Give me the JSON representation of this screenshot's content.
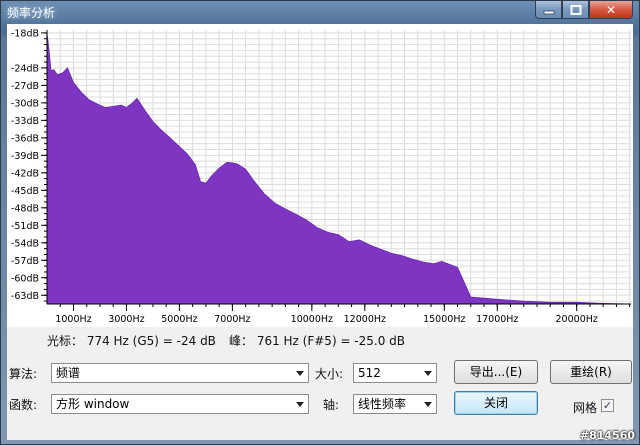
{
  "window": {
    "title": "频率分析",
    "min_label": "",
    "max_label": "",
    "close_label": "✕"
  },
  "chart_data": {
    "type": "area",
    "title": "",
    "xlabel": "",
    "ylabel": "",
    "xlim": [
      0,
      22050
    ],
    "ylim": [
      -64.5,
      -17.5
    ],
    "fill_color": "#7d35c2",
    "grid": true,
    "y_ticks": [
      {
        "v": -18,
        "label": "-18dB"
      },
      {
        "v": -24,
        "label": "-24dB"
      },
      {
        "v": -27,
        "label": "-27dB"
      },
      {
        "v": -30,
        "label": "-30dB"
      },
      {
        "v": -33,
        "label": "-33dB"
      },
      {
        "v": -36,
        "label": "-36dB"
      },
      {
        "v": -39,
        "label": "-39dB"
      },
      {
        "v": -42,
        "label": "-42dB"
      },
      {
        "v": -45,
        "label": "-45dB"
      },
      {
        "v": -48,
        "label": "-48dB"
      },
      {
        "v": -51,
        "label": "-51dB"
      },
      {
        "v": -54,
        "label": "-54dB"
      },
      {
        "v": -57,
        "label": "-57dB"
      },
      {
        "v": -60,
        "label": "-60dB"
      },
      {
        "v": -63,
        "label": "-63dB"
      }
    ],
    "x_ticks": [
      {
        "v": 1000,
        "label": "1000Hz"
      },
      {
        "v": 3000,
        "label": "3000Hz"
      },
      {
        "v": 5000,
        "label": "5000Hz"
      },
      {
        "v": 7000,
        "label": "7000Hz"
      },
      {
        "v": 10000,
        "label": "10000Hz"
      },
      {
        "v": 12000,
        "label": "12000Hz"
      },
      {
        "v": 15000,
        "label": "15000Hz"
      },
      {
        "v": 17000,
        "label": "17000Hz"
      },
      {
        "v": 20000,
        "label": "20000Hz"
      }
    ],
    "series": [
      {
        "x": [
          0,
          80,
          150,
          250,
          400,
          600,
          774,
          1000,
          1300,
          1600,
          1900,
          2200,
          2500,
          2800,
          3000,
          3200,
          3400,
          3700,
          4000,
          4300,
          4600,
          5000,
          5300,
          5600,
          5800,
          6000,
          6200,
          6500,
          6800,
          7000,
          7200,
          7500,
          7800,
          8200,
          8600,
          9000,
          9400,
          9800,
          10200,
          10600,
          11000,
          11400,
          11800,
          12200,
          12600,
          13000,
          13400,
          13800,
          14200,
          14600,
          14900,
          15200,
          15500,
          16000,
          17000,
          18000,
          19000,
          20000,
          21000,
          22050
        ],
        "y": [
          -18,
          -21,
          -24.5,
          -24.3,
          -25.2,
          -24.8,
          -24,
          -26.5,
          -28.2,
          -29.5,
          -30.2,
          -30.8,
          -30.6,
          -30.4,
          -30.8,
          -30.1,
          -29.2,
          -31.3,
          -33.2,
          -34.6,
          -35.8,
          -37.5,
          -38.8,
          -40.6,
          -43.5,
          -43.8,
          -42.6,
          -41.2,
          -40.2,
          -40.3,
          -40.5,
          -41.4,
          -43.3,
          -45.6,
          -47.2,
          -48.2,
          -49.1,
          -50.1,
          -51.4,
          -52.2,
          -52.6,
          -53.8,
          -53.5,
          -54.4,
          -55.1,
          -55.8,
          -56.2,
          -56.8,
          -57.3,
          -57.6,
          -57.2,
          -57.7,
          -58.2,
          -63.3,
          -63.7,
          -64,
          -64.2,
          -64.2,
          -64.4,
          -64.5
        ]
      }
    ]
  },
  "readout": {
    "cursor": "光标： 774 Hz (G5) = -24 dB",
    "peak": "峰： 761 Hz (F#5) = -25.0 dB"
  },
  "controls": {
    "algorithm_label": "算法:",
    "algorithm_value": "频谱",
    "function_label": "函数:",
    "function_value": "方形 window",
    "size_label": "大小:",
    "size_value": "512",
    "axis_label": "轴:",
    "axis_value": "线性频率",
    "export_button": "导出...(E)",
    "replot_button": "重绘(R)",
    "close_button": "关闭",
    "grid_label": "网格",
    "grid_checked": "✓"
  },
  "badge": "#814560"
}
